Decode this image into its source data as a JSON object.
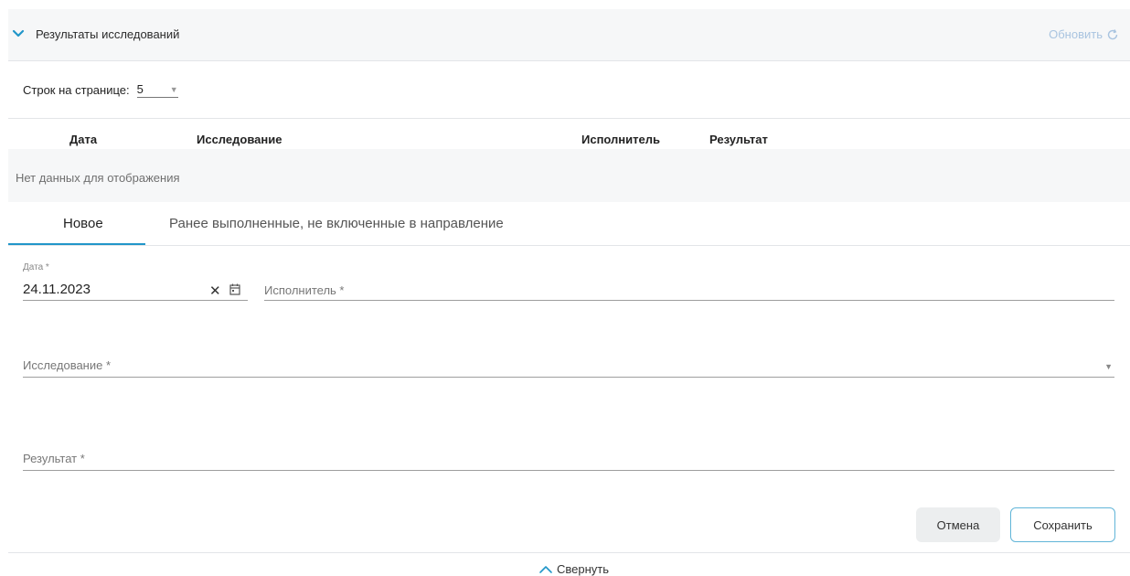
{
  "header": {
    "title": "Результаты исследований",
    "refresh_label": "Обновить",
    "accent_color": "#2196c9"
  },
  "pagination": {
    "rows_label": "Строк на странице:",
    "rows_value": "5"
  },
  "table": {
    "columns": [
      "Дата",
      "Исследование",
      "Исполнитель",
      "Результат"
    ],
    "empty_text": "Нет данных для отображения"
  },
  "tabs": [
    {
      "label": "Новое",
      "active": true
    },
    {
      "label": "Ранее выполненные, не включенные в направление",
      "active": false
    }
  ],
  "form": {
    "date_label": "Дата *",
    "date_value": "24.11.2023",
    "executor_placeholder": "Исполнитель *",
    "study_placeholder": "Исследование *",
    "result_placeholder": "Результат *"
  },
  "actions": {
    "cancel_label": "Отмена",
    "save_label": "Сохранить"
  },
  "footer": {
    "collapse_label": "Свернуть"
  }
}
